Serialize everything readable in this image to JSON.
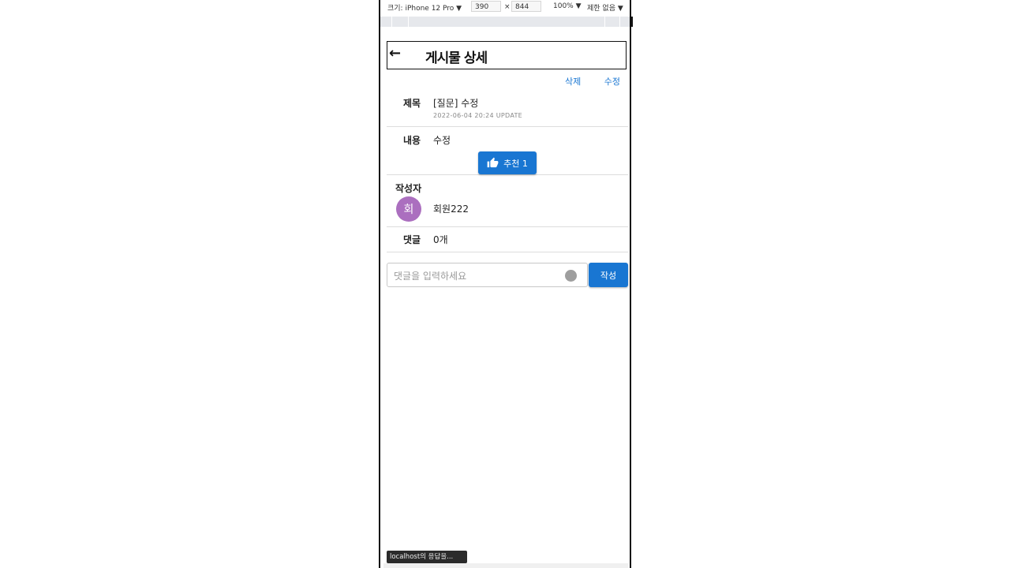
{
  "devtools": {
    "device_label": "크기: iPhone 12 Pro ▼",
    "width": "390",
    "times": "×",
    "height": "844",
    "zoom": "100% ▼",
    "throttle": "제한 없음 ▼"
  },
  "header": {
    "back_icon": "←",
    "title": "게시물 상세"
  },
  "actions": {
    "delete": "삭제",
    "edit": "수정"
  },
  "post": {
    "title_label": "제목",
    "title": "[질문] 수정",
    "updated": "2022-06-04 20:24 UPDATE",
    "content_label": "내용",
    "content": "수정",
    "like_label": "추천 1",
    "author_label": "작성자",
    "avatar_initial": "회",
    "author": "회원222",
    "comments_label": "댓글",
    "comments_count": "0개"
  },
  "comment_form": {
    "placeholder": "댓글을 입력하세요",
    "submit": "작성"
  },
  "status_bar": "localhost의 응답을...",
  "colors": {
    "primary": "#1976d2",
    "avatar": "#ab6fbf"
  }
}
